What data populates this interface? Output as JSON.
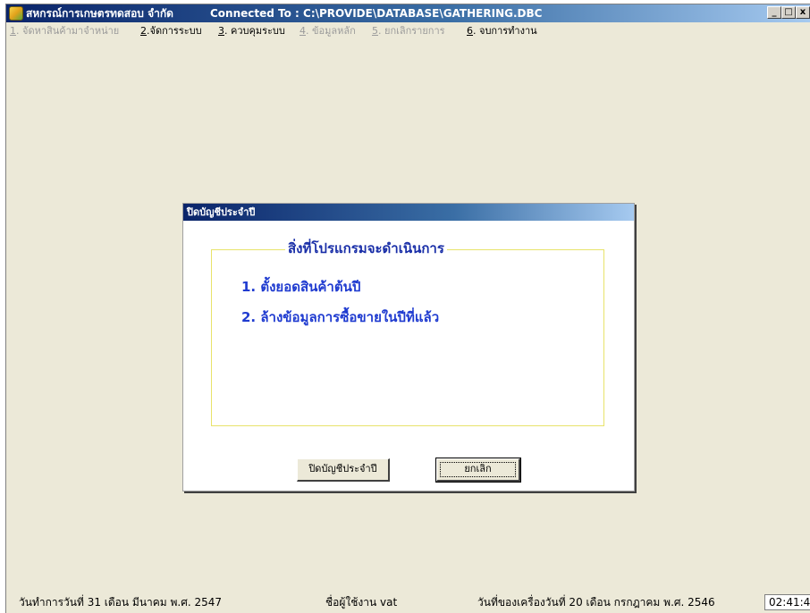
{
  "window": {
    "title": "สหกรณ์การเกษตรทดสอบ จำกัด",
    "connection": "Connected To : C:\\PROVIDE\\DATABASE\\GATHERING.DBC",
    "buttons": {
      "minimize": "_",
      "maximize": "□",
      "close": "x"
    }
  },
  "menu": [
    {
      "num": "1",
      "label": ". จัดหาสินค้ามาจำหน่าย",
      "enabled": false
    },
    {
      "num": "2",
      "label": ".จัดการระบบ",
      "enabled": true
    },
    {
      "num": "3",
      "label": ". ควบคุมระบบ",
      "enabled": true
    },
    {
      "num": "4",
      "label": ". ข้อมูลหลัก",
      "enabled": false
    },
    {
      "num": "5",
      "label": ". ยกเลิกรายการ",
      "enabled": false
    },
    {
      "num": "6",
      "label": ". จบการทำงาน",
      "enabled": true
    }
  ],
  "dialog": {
    "title": "ปิดบัญชีประจำปี",
    "group_title": "สิ่งที่โปรแกรมจะดำเนินการ",
    "tasks": [
      "1. ตั้งยอดสินค้าต้นปี",
      "2. ล้างข้อมูลการซื้อขายในปีที่แล้ว"
    ],
    "confirm_label": "ปิดบัญชีประจำปี",
    "cancel_label": "ยกเลิก"
  },
  "status": {
    "work_date": "วันทำการวันที่ 31 เดือน มีนาคม  พ.ศ. 2547",
    "user": "ชื่อผู้ใช้งาน vat",
    "machine_date": "วันที่ของเครื่องวันที่ 20 เดือน กรกฎาคม  พ.ศ. 2546",
    "clock": "02:41:4"
  }
}
